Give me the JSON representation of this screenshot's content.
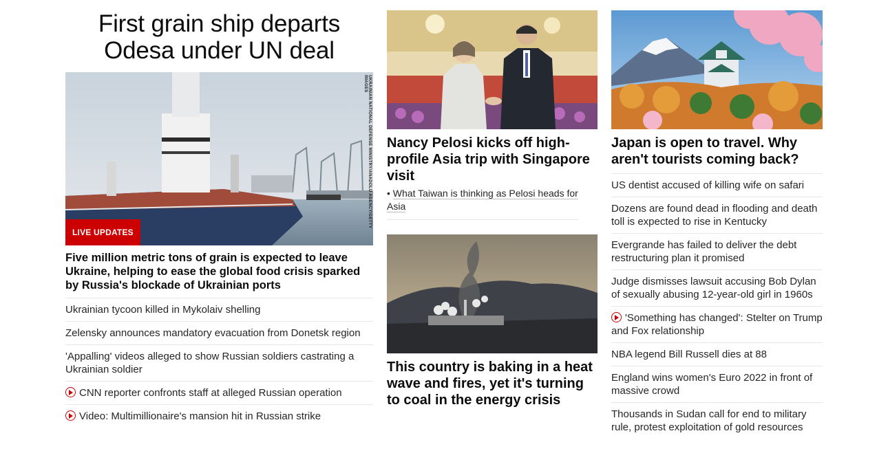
{
  "column1": {
    "title": "First grain ship departs Odesa under UN deal",
    "image_credit": "UKRAINIAN NATIONAL DEFENSE MINISTRY/ANADOLU AGENCY/GETTY IMAGES",
    "badge": "LIVE UPDATES",
    "lead": "Five million metric tons of grain is expected to leave Ukraine, helping to ease the global food crisis sparked by Russia's blockade of Ukrainian ports",
    "links": [
      {
        "text": "Ukrainian tycoon killed in Mykolaiv shelling",
        "video": false
      },
      {
        "text": "Zelensky announces mandatory evacuation from Donetsk region",
        "video": false
      },
      {
        "text": "'Appalling' videos alleged to show Russian soldiers castrating a Ukrainian soldier",
        "video": false
      },
      {
        "text": "CNN reporter confronts staff at alleged Russian operation",
        "video": true
      },
      {
        "text": "Video: Multimillionaire's mansion hit in Russian strike",
        "video": true
      }
    ]
  },
  "column2": {
    "story1": {
      "headline": "Nancy Pelosi kicks off high-profile Asia trip with Singapore visit",
      "sub_link": "What Taiwan is thinking as Pelosi heads for Asia"
    },
    "story2": {
      "headline": "This country is baking in a heat wave and fires, yet it's turning to coal in the energy crisis"
    }
  },
  "column3": {
    "headline": "Japan is open to travel. Why aren't tourists coming back?",
    "links": [
      {
        "text": "US dentist accused of killing wife on safari",
        "video": false
      },
      {
        "text": "Dozens are found dead in flooding and death toll is expected to rise in Kentucky",
        "video": false
      },
      {
        "text": "Evergrande has failed to deliver the debt restructuring plan it promised",
        "video": false
      },
      {
        "text": "Judge dismisses lawsuit accusing Bob Dylan of sexually abusing 12-year-old girl in 1960s",
        "video": false
      },
      {
        "text": "'Something has changed': Stelter on Trump and Fox relationship",
        "video": true
      },
      {
        "text": "NBA legend Bill Russell dies at 88",
        "video": false
      },
      {
        "text": "England wins women's Euro 2022 in front of massive crowd",
        "video": false
      },
      {
        "text": "Thousands in Sudan call for end to military rule, protest exploitation of gold resources",
        "video": false
      }
    ]
  },
  "colors": {
    "accent_red": "#cc0000",
    "divider": "#e6e6e6",
    "text": "#0c0c0c"
  },
  "icons": {
    "video": "play-circle-icon"
  }
}
